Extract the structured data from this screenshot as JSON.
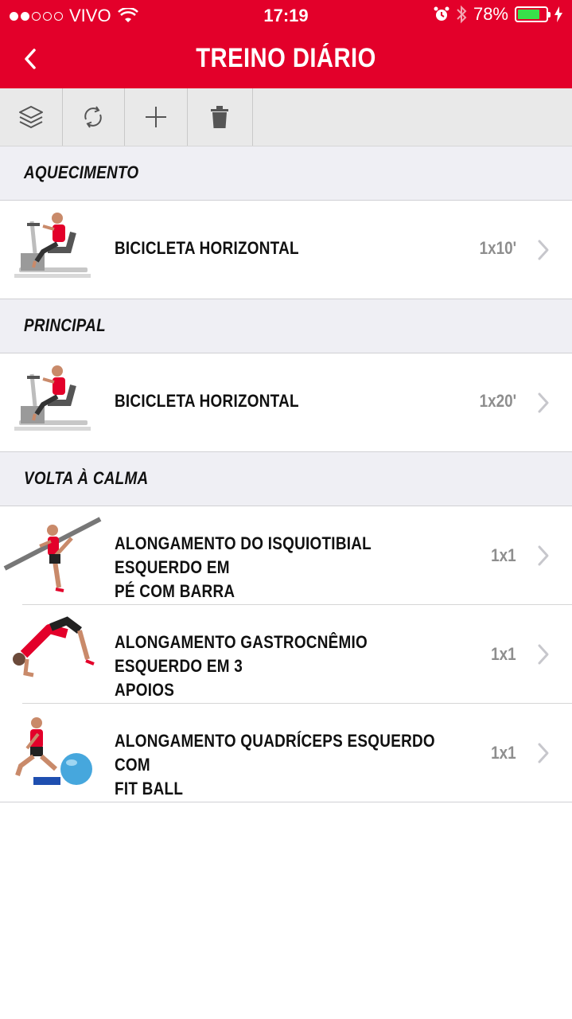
{
  "status": {
    "carrier": "VIVO",
    "time": "17:19",
    "battery_percent": "78%",
    "battery_level": 0.78,
    "signal_bars": 2,
    "icons": [
      "wifi-icon",
      "alarm-icon",
      "bluetooth-icon",
      "charging-icon"
    ]
  },
  "header": {
    "title": "TREINO DIÁRIO",
    "back_icon": "chevron-left-icon"
  },
  "toolbar": {
    "buttons": [
      {
        "icon": "layers-icon"
      },
      {
        "icon": "refresh-icon"
      },
      {
        "icon": "plus-icon"
      },
      {
        "icon": "trash-icon"
      }
    ]
  },
  "sections": [
    {
      "title": "AQUECIMENTO",
      "exercises": [
        {
          "name": "BICICLETA HORIZONTAL",
          "qty": "1x10'",
          "image": "recumbent-bike"
        }
      ]
    },
    {
      "title": "PRINCIPAL",
      "exercises": [
        {
          "name": "BICICLETA HORIZONTAL",
          "qty": "1x20'",
          "image": "recumbent-bike"
        }
      ]
    },
    {
      "title": "VOLTA À CALMA",
      "exercises": [
        {
          "name_line1": "ALONGAMENTO DO ISQUIOTIBIAL ESQUERDO  EM",
          "name_line2": "PÉ COM BARRA",
          "qty": "1x1",
          "image": "hamstring-bar-stretch"
        },
        {
          "name_line1": "ALONGAMENTO GASTROCNÊMIO ESQUERDO EM 3",
          "name_line2": "APOIOS",
          "qty": "1x1",
          "image": "calf-stretch"
        },
        {
          "name_line1": "ALONGAMENTO QUADRÍCEPS ESQUERDO COM",
          "name_line2": "FIT BALL",
          "qty": "1x1",
          "image": "quad-fitball-stretch"
        }
      ]
    }
  ],
  "colors": {
    "brand_red": "#e3002a",
    "section_bg": "#efeff4",
    "toolbar_bg": "#e9e9e9",
    "qty_gray": "#8e8e8e",
    "battery_green": "#38e04a"
  }
}
